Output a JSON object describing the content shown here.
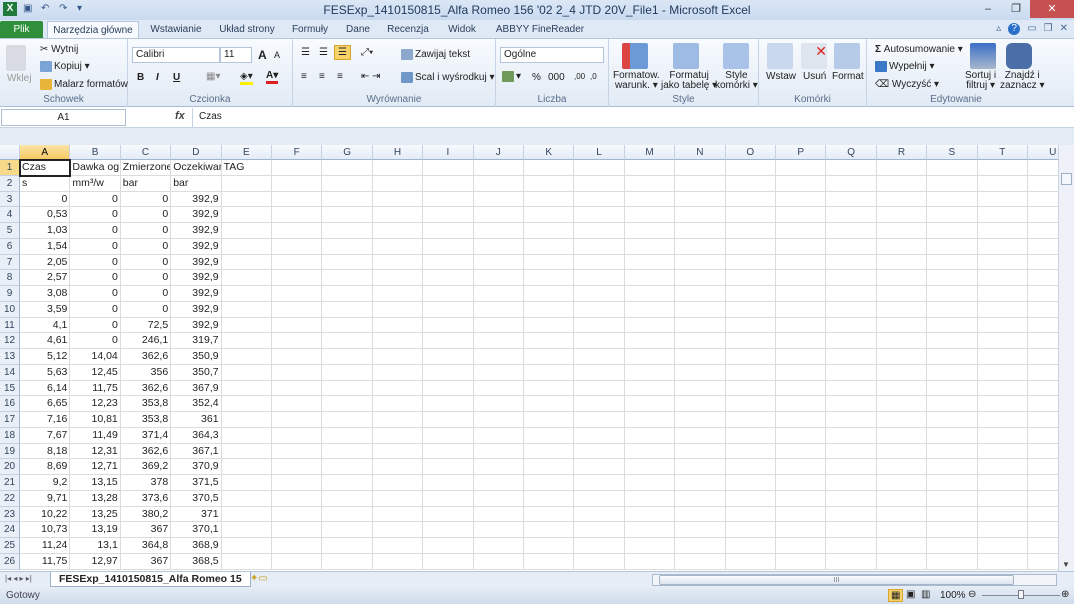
{
  "window": {
    "title": "FESExp_1410150815_Alfa Romeo 156 '02 2_4 JTD 20V_File1  -  Microsoft Excel",
    "minimize": "–",
    "restore": "❐",
    "close": "✕"
  },
  "ribbon_tabs": [
    "Plik",
    "Narzędzia główne",
    "Wstawianie",
    "Układ strony",
    "Formuły",
    "Dane",
    "Recenzja",
    "Widok",
    "ABBYY FineReader 11"
  ],
  "clipboard": {
    "group": "Schowek",
    "paste": "Wklej",
    "cut": "Wytnij",
    "copy": "Kopiuj ▾",
    "painter": "Malarz formatów"
  },
  "font": {
    "group": "Czcionka",
    "name": "Calibri",
    "size": "11",
    "bold": "B",
    "italic": "I",
    "underline": "U",
    "grow": "A",
    "shrink": "A"
  },
  "alignment": {
    "group": "Wyrównanie",
    "wrap": "Zawijaj tekst",
    "merge": "Scal i wyśrodkuj ▾"
  },
  "number": {
    "group": "Liczba",
    "format": "Ogólne",
    "percent": "%",
    "thousands": "000",
    "inc": ",00",
    "dec": ",0"
  },
  "styles": {
    "group": "Style",
    "cond": [
      "Formatow.",
      "warunk. ▾"
    ],
    "table": [
      "Formatuj",
      "jako tabelę ▾"
    ],
    "cell": [
      "Style",
      "komórki ▾"
    ]
  },
  "cells": {
    "group": "Komórki",
    "insert": "Wstaw",
    "delete": "Usuń",
    "format": "Format"
  },
  "editing": {
    "group": "Edytowanie",
    "autosum": "Autosumowanie ▾",
    "fill": "Wypełnij ▾",
    "clear": "Wyczyść ▾",
    "sort": [
      "Sortuj i",
      "filtruj ▾"
    ],
    "find": [
      "Znajdź i",
      "zaznacz ▾"
    ]
  },
  "formula_bar": {
    "name_box": "A1",
    "fx": "fx",
    "value": "Czas"
  },
  "sheet": {
    "columns": [
      "A",
      "B",
      "C",
      "D",
      "E",
      "F",
      "G",
      "H",
      "I",
      "J",
      "K",
      "L",
      "M",
      "N",
      "O",
      "P",
      "Q",
      "R",
      "S",
      "T",
      "U"
    ],
    "selected_cell": "A1",
    "rows": [
      [
        "Czas",
        "Dawka og",
        "Zmierzone",
        "Oczekiwan",
        "TAG"
      ],
      [
        "s",
        "mm³/w",
        "bar",
        "bar"
      ],
      [
        "0",
        "0",
        "0",
        "392,9"
      ],
      [
        "0,53",
        "0",
        "0",
        "392,9"
      ],
      [
        "1,03",
        "0",
        "0",
        "392,9"
      ],
      [
        "1,54",
        "0",
        "0",
        "392,9"
      ],
      [
        "2,05",
        "0",
        "0",
        "392,9"
      ],
      [
        "2,57",
        "0",
        "0",
        "392,9"
      ],
      [
        "3,08",
        "0",
        "0",
        "392,9"
      ],
      [
        "3,59",
        "0",
        "0",
        "392,9"
      ],
      [
        "4,1",
        "0",
        "72,5",
        "392,9"
      ],
      [
        "4,61",
        "0",
        "246,1",
        "319,7"
      ],
      [
        "5,12",
        "14,04",
        "362,6",
        "350,9"
      ],
      [
        "5,63",
        "12,45",
        "356",
        "350,7"
      ],
      [
        "6,14",
        "11,75",
        "362,6",
        "367,9"
      ],
      [
        "6,65",
        "12,23",
        "353,8",
        "352,4"
      ],
      [
        "7,16",
        "10,81",
        "353,8",
        "361"
      ],
      [
        "7,67",
        "11,49",
        "371,4",
        "364,3"
      ],
      [
        "8,18",
        "12,31",
        "362,6",
        "367,1"
      ],
      [
        "8,69",
        "12,71",
        "369,2",
        "370,9"
      ],
      [
        "9,2",
        "13,15",
        "378",
        "371,5"
      ],
      [
        "9,71",
        "13,28",
        "373,6",
        "370,5"
      ],
      [
        "10,22",
        "13,25",
        "380,2",
        "371"
      ],
      [
        "10,73",
        "13,19",
        "367",
        "370,1"
      ],
      [
        "11,24",
        "13,1",
        "364,8",
        "368,9"
      ],
      [
        "11,75",
        "12,97",
        "367",
        "368,5"
      ]
    ]
  },
  "sheet_tabs": [
    "FESExp_1410150815_Alfa Romeo 15"
  ],
  "status": {
    "ready": "Gotowy",
    "zoom": "100%",
    "zoom_percent": 100
  }
}
